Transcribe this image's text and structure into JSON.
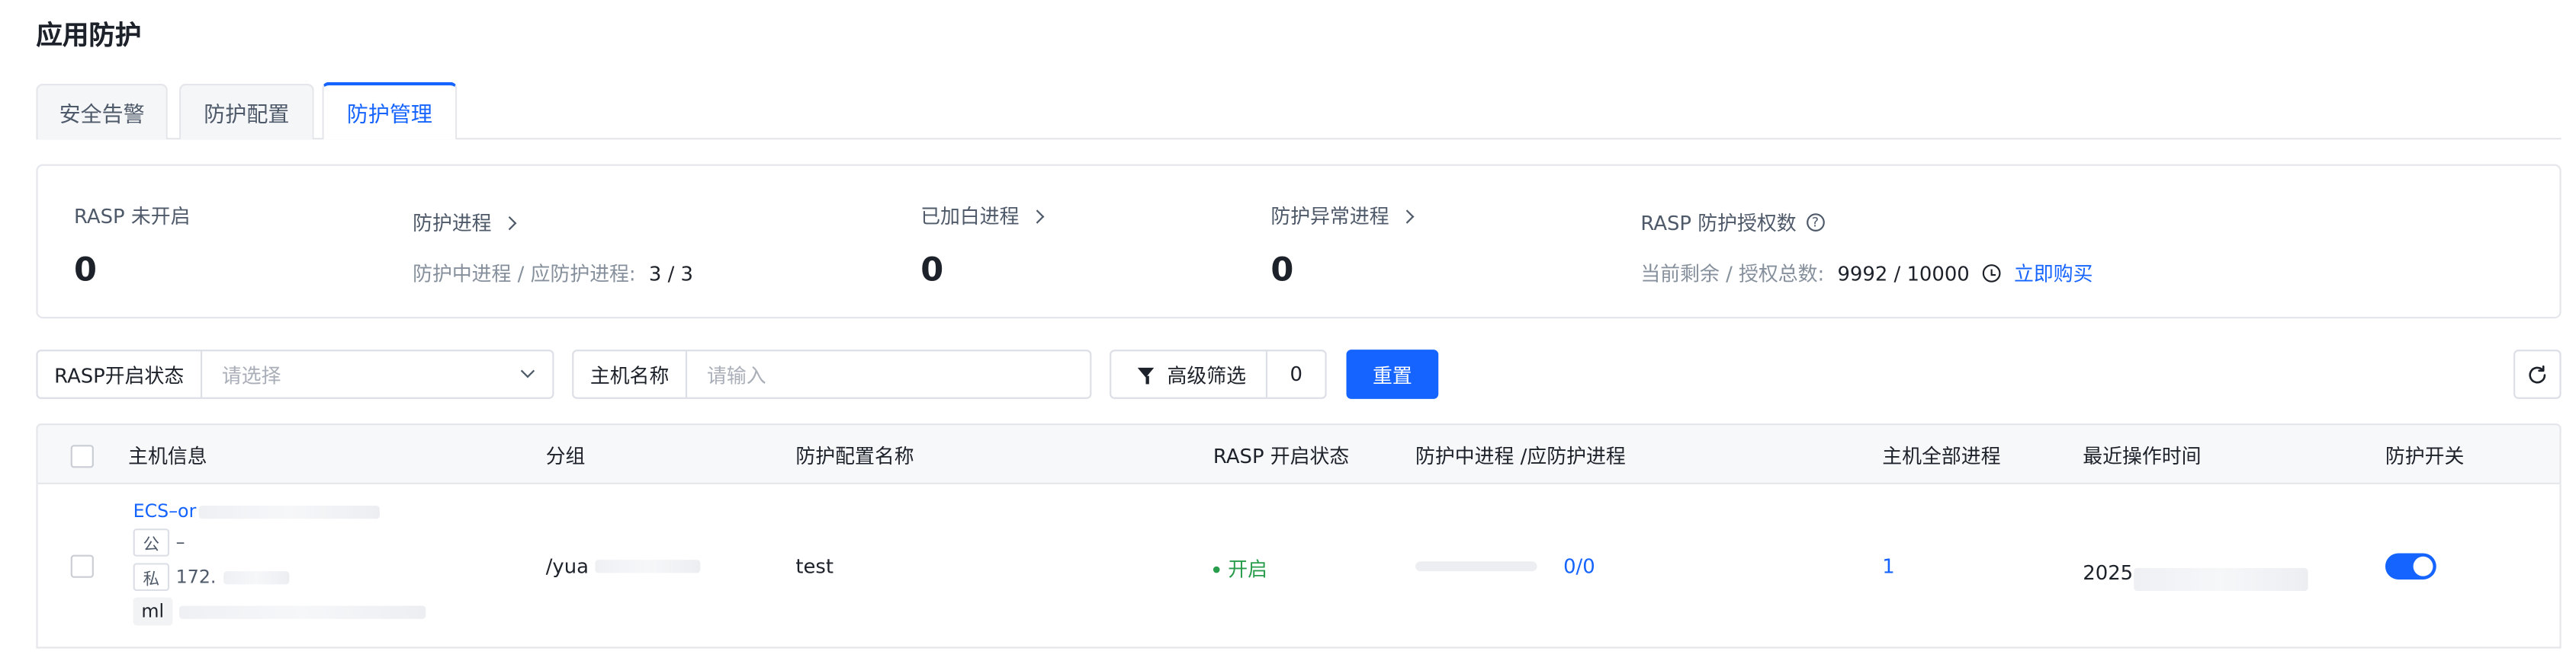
{
  "page": {
    "title": "应用防护"
  },
  "tabs": [
    {
      "label": "安全告警"
    },
    {
      "label": "防护配置"
    },
    {
      "label": "防护管理",
      "active": true
    }
  ],
  "summary": {
    "rasp_off": {
      "label": "RASP 未开启",
      "value": "0"
    },
    "protect_process": {
      "label": "防护进程",
      "sub_label": "防护中进程 / 应防护进程:",
      "sub_value": "3 / 3"
    },
    "whitelisted": {
      "label": "已加白进程",
      "value": "0"
    },
    "abnormal": {
      "label": "防护异常进程",
      "value": "0"
    },
    "license": {
      "label": "RASP 防护授权数",
      "sub_label": "当前剩余 / 授权总数:",
      "sub_value": "9992 / 10000",
      "buy": "立即购买"
    }
  },
  "filters": {
    "rasp_status": {
      "label": "RASP开启状态",
      "placeholder": "请选择"
    },
    "host_name": {
      "label": "主机名称",
      "placeholder": "请输入"
    },
    "advanced": {
      "label": "高级筛选",
      "count": "0"
    },
    "reset": "重置"
  },
  "table": {
    "headers": {
      "host": "主机信息",
      "group": "分组",
      "config": "防护配置名称",
      "rasp_status": "RASP 开启状态",
      "process": "防护中进程 /应防护进程",
      "all_process": "主机全部进程",
      "last_op": "最近操作时间",
      "switch": "防护开关"
    },
    "rows": [
      {
        "host_name": "ECS–or",
        "public_tag": "公",
        "public_ip": "–",
        "private_tag": "私",
        "private_ip": "172.",
        "extra": "ml",
        "group": "/yua",
        "config": "test",
        "rasp_status": "开启",
        "process": "0/0",
        "process_fraction": 0,
        "all_process": "1",
        "last_op": "2025",
        "switch_on": true
      }
    ]
  },
  "colors": {
    "primary": "#1664ff",
    "success": "#2a9d4c",
    "border": "#e5e6eb"
  }
}
